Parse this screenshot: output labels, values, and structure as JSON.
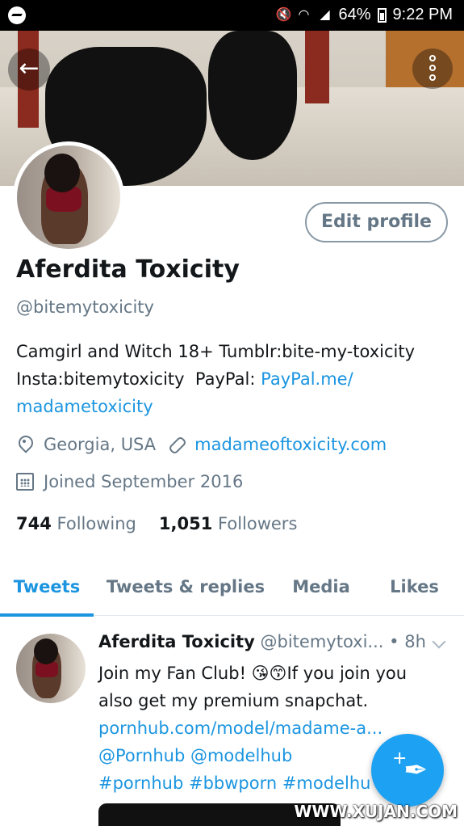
{
  "status_bar": {
    "battery_percent": "64%",
    "time": "9:22 PM",
    "icons": [
      "messenger-icon",
      "mute-icon",
      "wifi-icon",
      "signal-icon",
      "battery-icon"
    ]
  },
  "header": {
    "back_icon": "arrow-left-icon",
    "more_icon": "more-vertical-icon"
  },
  "profile": {
    "edit_button_label": "Edit profile",
    "name": "Aferdita Toxicity",
    "handle": "@bitemytoxicity",
    "bio_line1": "Camgirl and Witch 18+ Tumblr:bite-my-toxicity",
    "bio_line2_text": "Insta:bitemytoxicity  PayPal: ",
    "bio_link_part1": "PayPal.me/",
    "bio_link_part2": "madametoxicity",
    "location": "Georgia, USA",
    "website": "madameoftoxicity.com",
    "joined": "Joined September 2016",
    "following_count": "744",
    "following_label": "Following",
    "followers_count": "1,051",
    "followers_label": "Followers"
  },
  "tabs": [
    {
      "label": "Tweets",
      "active": true
    },
    {
      "label": "Tweets & replies",
      "active": false
    },
    {
      "label": "Media",
      "active": false
    },
    {
      "label": "Likes",
      "active": false
    }
  ],
  "tweet": {
    "name": "Aferdita Toxicity",
    "handle": "@bitemytoxi...",
    "time": "• 8h",
    "line1": "Join my Fan Club! 😘😙If you join you",
    "line2": "also get my premium snapchat.",
    "link": "pornhub.com/model/madame-a...",
    "mentions": "@Pornhub @modelhub",
    "hashtags": "#pornhub #bbwporn #modelhu"
  },
  "fab": {
    "icon": "compose-tweet-icon",
    "plus": "+",
    "quill": "✒"
  },
  "watermark": "WWW.XUJAN.COM",
  "colors": {
    "accent": "#1b95e0",
    "secondary_text": "#657786",
    "fab": "#1da1f2"
  }
}
